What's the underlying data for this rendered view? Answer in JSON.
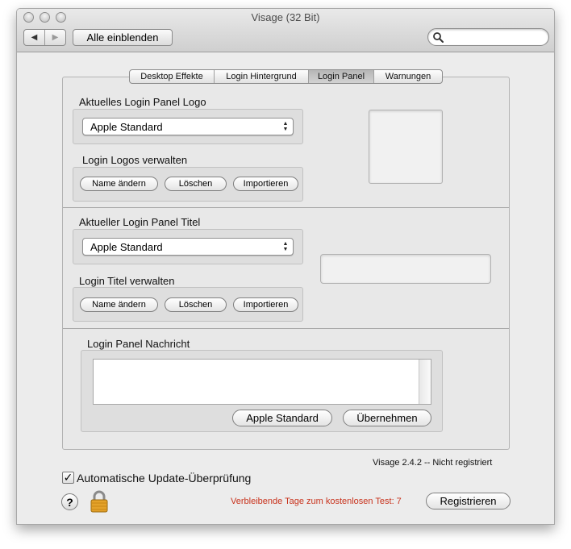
{
  "window": {
    "title": "Visage (32 Bit)"
  },
  "toolbar": {
    "back_glyph": "◀",
    "forward_glyph": "▶",
    "show_all_label": "Alle einblenden",
    "search_placeholder": "",
    "search_value": ""
  },
  "tabs": [
    {
      "label": "Desktop Effekte",
      "active": false
    },
    {
      "label": "Login Hintergrund",
      "active": false
    },
    {
      "label": "Login Panel",
      "active": true
    },
    {
      "label": "Warnungen",
      "active": false
    }
  ],
  "logo_section": {
    "group_label": "Aktuelles Login Panel Logo",
    "selected_value": "Apple Standard",
    "manage_label": "Login Logos verwalten",
    "buttons": [
      "Name ändern",
      "Löschen",
      "Importieren"
    ]
  },
  "title_section": {
    "group_label": "Aktueller Login Panel Titel",
    "selected_value": "Apple Standard",
    "manage_label": "Login Titel verwalten",
    "buttons": [
      "Name ändern",
      "Löschen",
      "Importieren"
    ]
  },
  "message_section": {
    "group_label": "Login Panel Nachricht",
    "text": "",
    "apple_standard_button": "Apple Standard",
    "apply_button": "Übernehmen"
  },
  "footer": {
    "version_status": "Visage 2.4.2 -- Nicht registriert",
    "auto_update_label": "Automatische Update-Überprüfung",
    "auto_update_checked": true,
    "help_glyph": "?",
    "trial_text": "Verbleibende Tage zum kostenlosen Test: 7",
    "register_button": "Registrieren"
  },
  "colors": {
    "trial_text": "#c8321c",
    "window_bg": "#ececec"
  },
  "icons": [
    "search-icon",
    "back-arrow-icon",
    "forward-arrow-icon",
    "help-icon",
    "lock-icon",
    "popup-arrows-icon"
  ]
}
